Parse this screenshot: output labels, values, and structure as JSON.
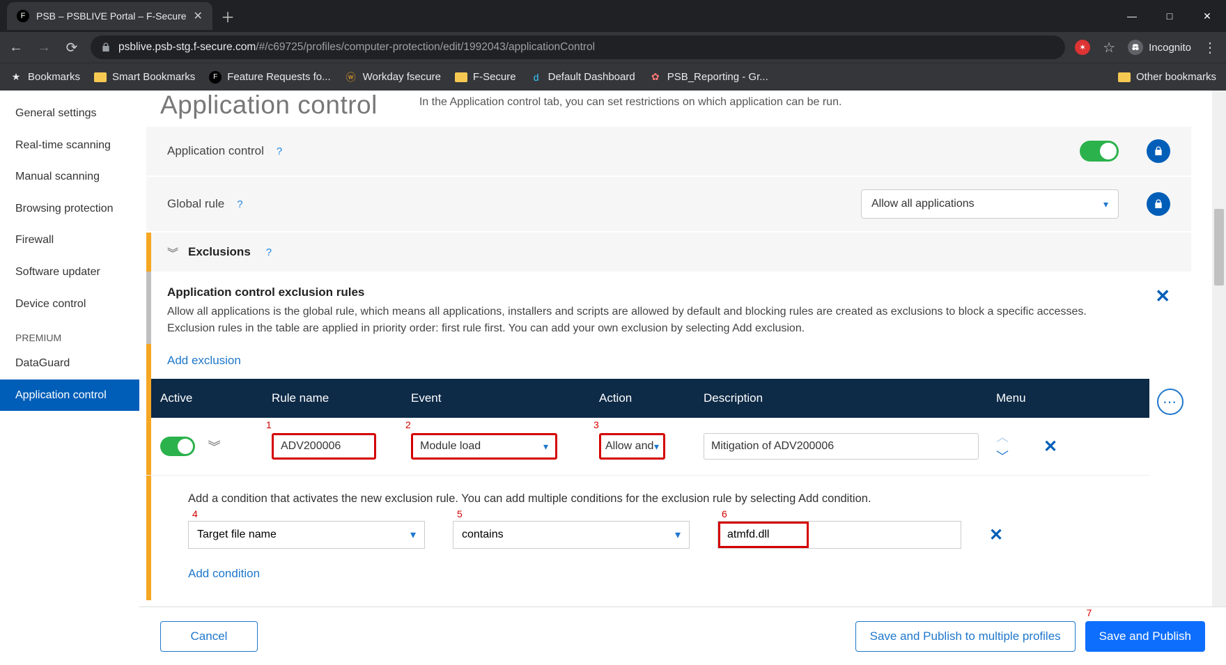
{
  "browser": {
    "tab_title": "PSB – PSBLIVE Portal – F-Secure",
    "url_host": "psblive.psb-stg.f-secure.com",
    "url_path": "/#/c69725/profiles/computer-protection/edit/1992043/applicationControl",
    "incognito_label": "Incognito",
    "bookmarks": [
      "Bookmarks",
      "Smart Bookmarks",
      "Feature Requests fo...",
      "Workday fsecure",
      "F-Secure",
      "Default Dashboard",
      "PSB_Reporting - Gr..."
    ],
    "other_bookmarks": "Other bookmarks"
  },
  "sidebar": {
    "items": [
      "General settings",
      "Real-time scanning",
      "Manual scanning",
      "Browsing protection",
      "Firewall",
      "Software updater",
      "Device control"
    ],
    "premium_label": "PREMIUM",
    "premium_items": [
      "DataGuard",
      "Application control"
    ],
    "active": "Application control"
  },
  "page": {
    "title": "Application control",
    "subtitle": "In the Application control tab, you can set restrictions on which application can be run."
  },
  "settings": {
    "app_control_label": "Application control",
    "app_control_on": true,
    "global_rule_label": "Global rule",
    "global_rule_value": "Allow all applications"
  },
  "exclusions": {
    "header": "Exclusions",
    "rules_title": "Application control exclusion rules",
    "rules_desc": "Allow all applications is the global rule, which means all applications, installers and scripts are allowed by default and blocking rules are created as exclusions to block a specific accesses. Exclusion rules in the table are applied in priority order: first rule first. You can add your own exclusion by selecting Add exclusion.",
    "add_exclusion": "Add exclusion",
    "columns": {
      "active": "Active",
      "rule": "Rule name",
      "event": "Event",
      "action": "Action",
      "desc": "Description",
      "menu": "Menu"
    },
    "row": {
      "active": true,
      "rule_name": "ADV200006",
      "event": "Module load",
      "action": "Allow and",
      "description": "Mitigation of ADV200006"
    },
    "condition_help": "Add a condition that activates the new exclusion rule. You can add multiple conditions for the exclusion rule by selecting Add condition.",
    "condition": {
      "field": "Target file name",
      "op": "contains",
      "value": "atmfd.dll"
    },
    "add_condition": "Add condition"
  },
  "footer": {
    "cancel": "Cancel",
    "save_multiple": "Save and Publish to multiple profiles",
    "save": "Save and Publish"
  },
  "annotations": {
    "n1": "1",
    "n2": "2",
    "n3": "3",
    "n4": "4",
    "n5": "5",
    "n6": "6",
    "n7": "7"
  }
}
